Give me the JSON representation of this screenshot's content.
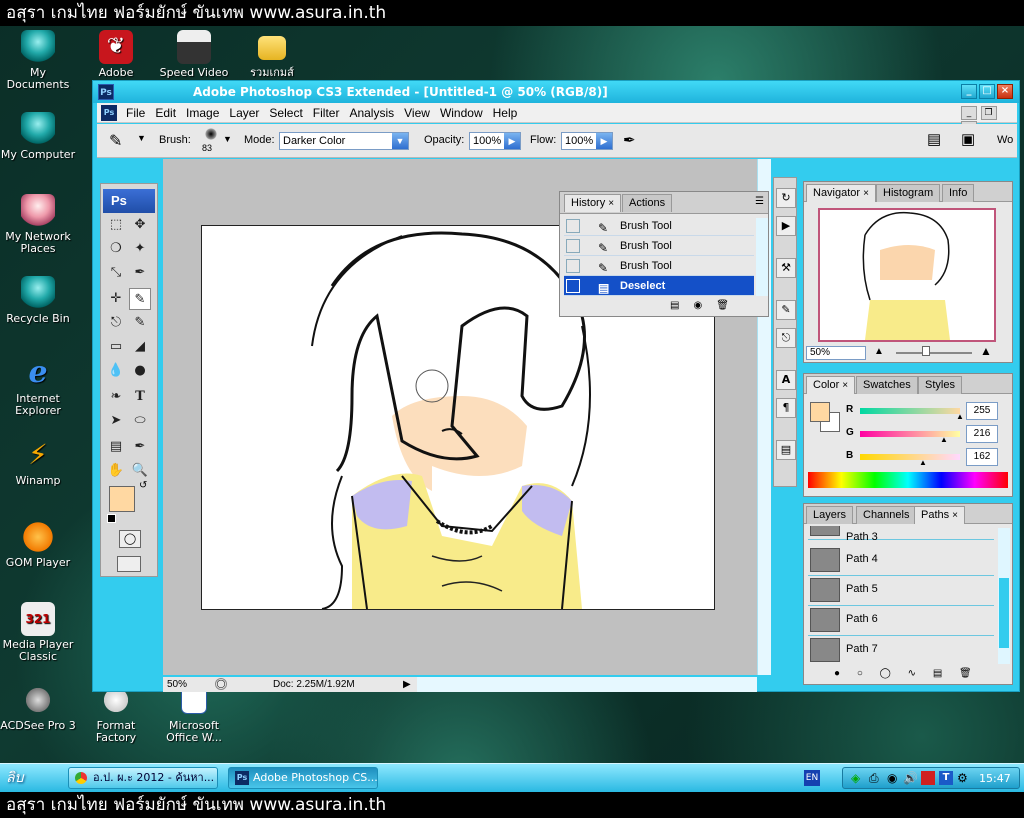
{
  "banner_top": "อสุรา เกมไทย ฟอร์มยักษ์ ขันเทพ www.asura.in.th",
  "banner_bottom": "อสุรา เกมไทย ฟอร์มยักษ์ ขันเทพ www.asura.in.th",
  "desktop_icons": [
    {
      "label": "My Documents",
      "icon": "miku-icon"
    },
    {
      "label": "Adobe Reader",
      "icon": "adobe-reader-icon"
    },
    {
      "label": "Speed Video",
      "icon": "clapper-icon"
    },
    {
      "label": "รวมเกมส์",
      "icon": "folder-icon"
    },
    {
      "label": "My Computer",
      "icon": "miku-icon"
    },
    {
      "label": "My Network Places",
      "icon": "miku-icon"
    },
    {
      "label": "Recycle Bin",
      "icon": "miku-icon"
    },
    {
      "label": "Internet Explorer",
      "icon": "ie-icon"
    },
    {
      "label": "Winamp",
      "icon": "winamp-icon"
    },
    {
      "label": "GOM Player",
      "icon": "gom-icon"
    },
    {
      "label": "Media Player Classic",
      "icon": "mpc-icon"
    },
    {
      "label": "ACDSee Pro 3",
      "icon": "acdsee-icon"
    },
    {
      "label": "Format Factory",
      "icon": "format-factory-icon"
    },
    {
      "label": "Microsoft Office W...",
      "icon": "word-icon"
    }
  ],
  "window": {
    "title": "Adobe Photoshop CS3 Extended - [Untitled-1 @ 50% (RGB/8)]",
    "controls": [
      "_",
      "□",
      "×"
    ]
  },
  "menu": [
    "File",
    "Edit",
    "Image",
    "Layer",
    "Select",
    "Filter",
    "Analysis",
    "View",
    "Window",
    "Help"
  ],
  "options": {
    "brush_label": "Brush:",
    "brush_size": "83",
    "mode_label": "Mode:",
    "mode_value": "Darker Color",
    "opacity_label": "Opacity:",
    "opacity_value": "100%",
    "flow_label": "Flow:",
    "flow_value": "100%",
    "workspace_short": "Wo"
  },
  "toolbox": {
    "header": "Ps"
  },
  "history_panel": {
    "tabs": [
      "History",
      "Actions"
    ],
    "rows": [
      "Brush Tool",
      "Brush Tool",
      "Brush Tool",
      "Deselect"
    ]
  },
  "navigator_panel": {
    "tabs": [
      "Navigator",
      "Histogram",
      "Info"
    ],
    "zoom": "50%"
  },
  "color_panel": {
    "tabs": [
      "Color",
      "Swatches",
      "Styles"
    ],
    "channels": [
      {
        "label": "R",
        "value": "255"
      },
      {
        "label": "G",
        "value": "216"
      },
      {
        "label": "B",
        "value": "162"
      }
    ],
    "foreground": "#ffd8a2"
  },
  "layers_panel": {
    "tabs": [
      "Layers",
      "Channels",
      "Paths"
    ],
    "paths": [
      "Path 3",
      "Path 4",
      "Path 5",
      "Path 6",
      "Path 7"
    ]
  },
  "status": {
    "zoom": "50%",
    "doc": "Doc: 2.25M/1.92M"
  },
  "taskbar": {
    "start_label": "ลิบ",
    "tasks": [
      {
        "label": "อ.ป. ผ.ะ 2012 - ค้นหา..."
      },
      {
        "label": "Adobe Photoshop CS..."
      }
    ],
    "lang": "EN",
    "clock": "15:47"
  }
}
